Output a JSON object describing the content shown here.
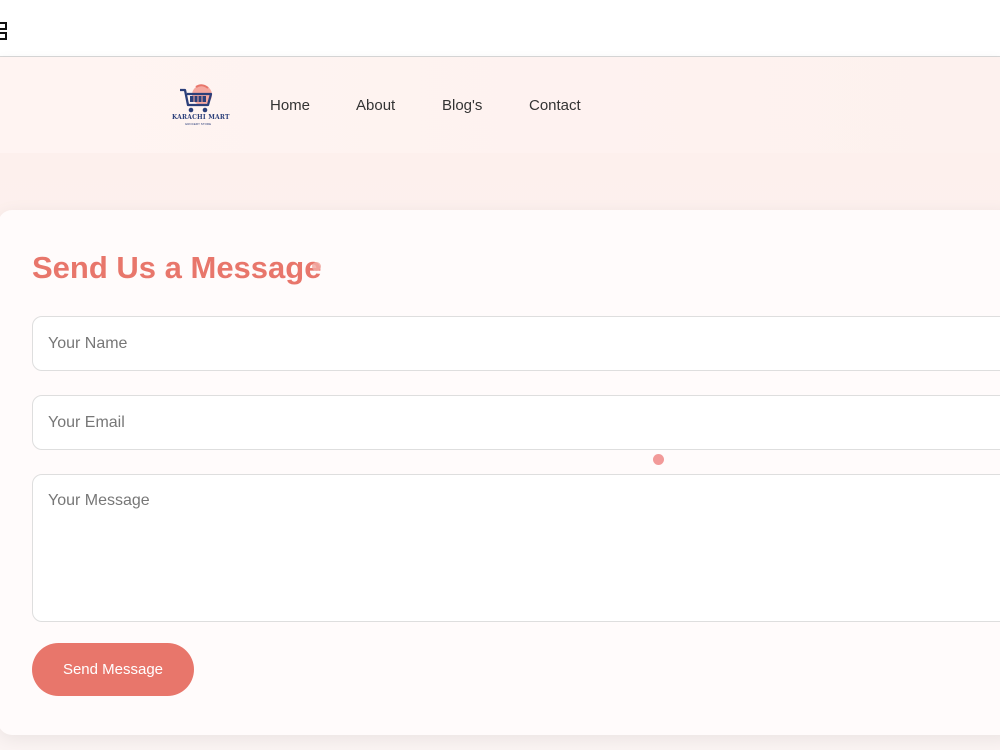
{
  "topbar": {
    "menu_icon": "grid-icon"
  },
  "brand": {
    "name": "KARACHI MART",
    "tagline": "GROCERY STORE",
    "logo_icon": "shopping-cart-logo"
  },
  "nav": {
    "items": [
      {
        "label": "Home"
      },
      {
        "label": "About"
      },
      {
        "label": "Blog's"
      },
      {
        "label": "Contact"
      }
    ]
  },
  "contact_form": {
    "title": "Send Us a Message",
    "name_placeholder": "Your Name",
    "email_placeholder": "Your Email",
    "message_placeholder": "Your Message",
    "submit_label": "Send Message"
  },
  "colors": {
    "accent": "#e8766b",
    "background": "#fdf3f1",
    "card": "#fffbfb",
    "logo_blue": "#2b3f7a"
  }
}
